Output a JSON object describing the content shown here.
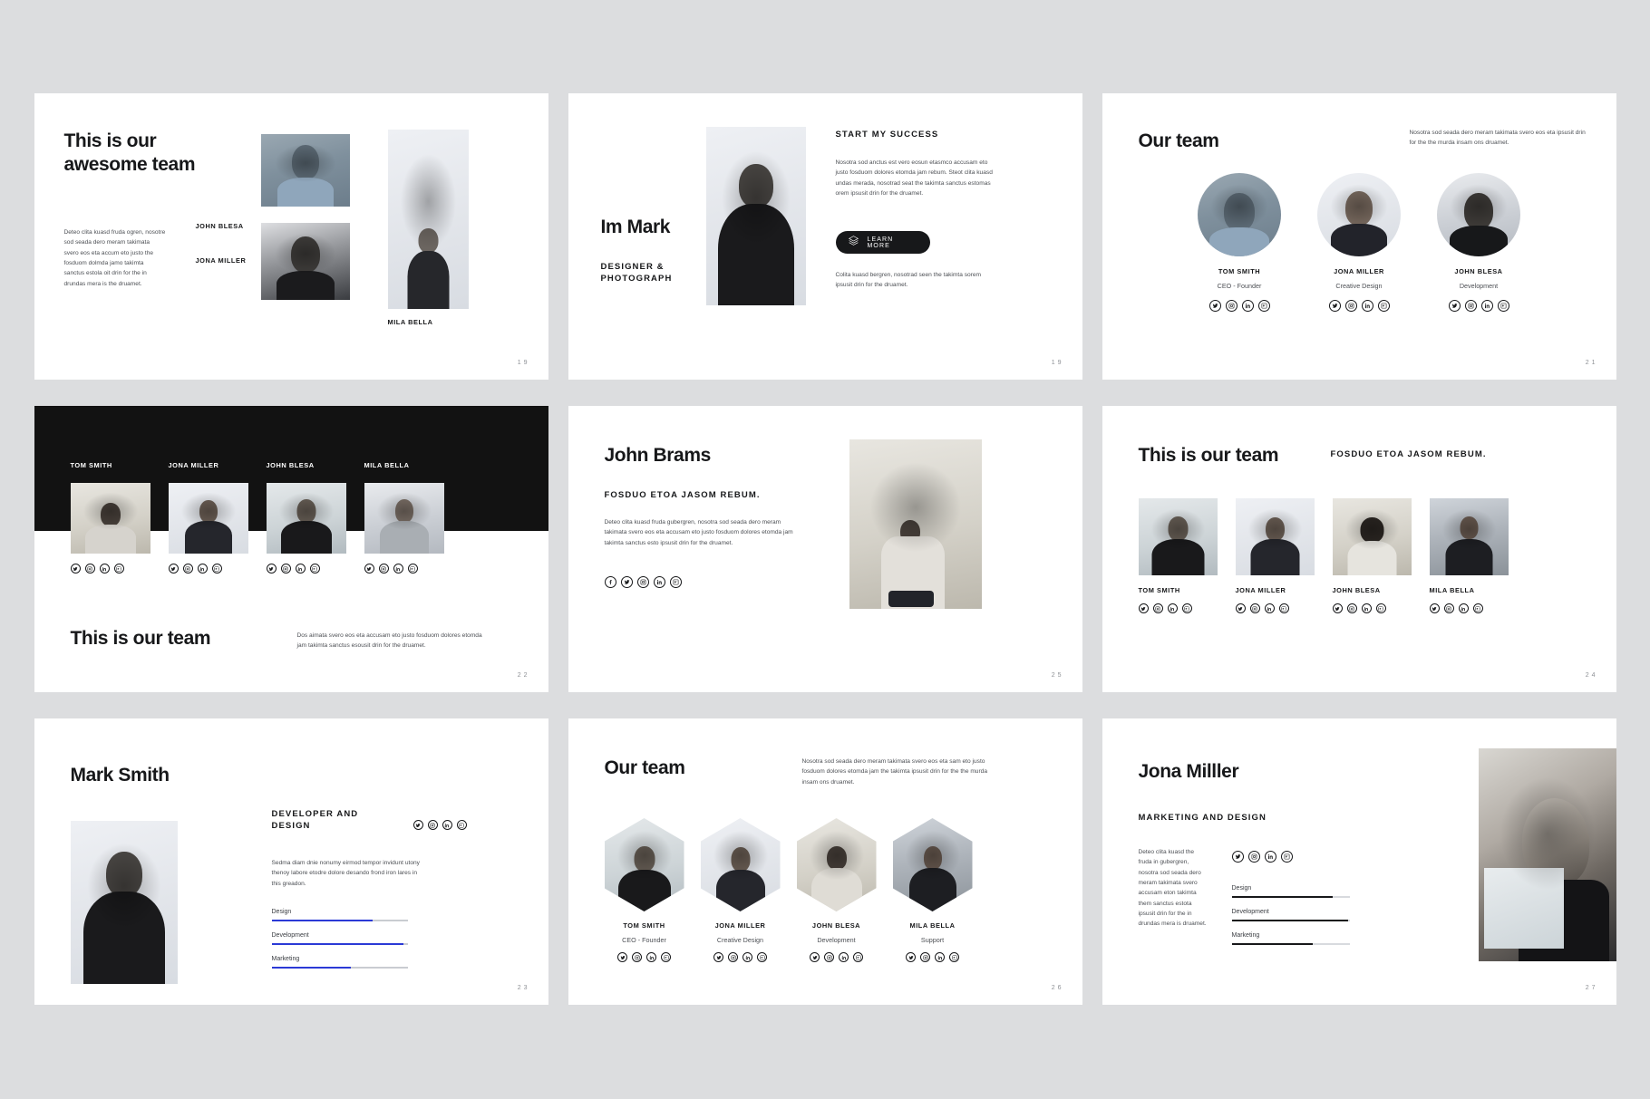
{
  "social_icons": [
    "twitter-icon",
    "instagram-icon",
    "linkedin-icon",
    "behance-icon"
  ],
  "social_icons_full": [
    "facebook-icon",
    "twitter-icon",
    "instagram-icon",
    "linkedin-icon",
    "behance-icon"
  ],
  "colors": {
    "accent": "#2b3ad6",
    "dark": "#121212",
    "body_text": "#4c4f54",
    "page_bg": "#dcdddf"
  },
  "slides": [
    {
      "id": "awesome-team",
      "page": "19",
      "title": "This is our\nawesome team",
      "paragraph": "Deteo clita kuasd fruda ogren, nosotre sod seada dero meram takimata svero eos eta accum eto justo the fosduom dolmda jamo takimta sanctus estola oit drin for the in drundas mera is the druamet.",
      "labels": {
        "john": "JOHN BLESA",
        "jona": "JONA MILLER",
        "mila": "MILA BELLA"
      }
    },
    {
      "id": "im-mark",
      "page": "19",
      "name": "Im Mark",
      "subtitle": "DESIGNER &\nPHOTOGRAPH",
      "kicker": "START MY SUCCESS",
      "paragraph": "Nosotra sod anctus est vero eosun etasmco accusam eto justo fosduom dolores etomda jam rebum. Steot clita kuasd undas merada, nosotrad seat the takimta sanctus estomas orem ipsusit drin for the druamet.",
      "button_label": "LEARN MORE",
      "paragraph2": "Colita kuasd bergren, nosotrad seen the takimta sorem ipsusit drin for the druamet."
    },
    {
      "id": "our-team-circles",
      "page": "21",
      "title": "Our team",
      "note": "Nosotra sod seada dero meram takimata svero eos eta ipsusit drin for the the murda insam ons druamet.",
      "members": [
        {
          "name": "TOM SMITH",
          "role": "CEO - Founder"
        },
        {
          "name": "JONA MILLER",
          "role": "Creative Design"
        },
        {
          "name": "JOHN BLESA",
          "role": "Development"
        }
      ]
    },
    {
      "id": "this-is-our-team-dark",
      "page": "22",
      "title": "This is our team",
      "paragraph": "Dos aimata svero eos eta accusam eto justo fosduom dolores etomda jam takimta sanctus esousit drin for the druamet.",
      "members": [
        {
          "name": "TOM SMITH"
        },
        {
          "name": "JONA MILLER"
        },
        {
          "name": "JOHN BLESA"
        },
        {
          "name": "MILA BELLA"
        }
      ]
    },
    {
      "id": "john-brams",
      "page": "25",
      "title": "John Brams",
      "kicker": "FOSDUO ETOA JASOM REBUM.",
      "paragraph": "Deteo clita kuasd fruda gubergren, nosotra sod seada dero meram takimata svero eos eta accusam eto justo fosduom dolores etomda jam takimta sanctus esto ipsusit drin for the druamet."
    },
    {
      "id": "this-is-our-team-light",
      "page": "24",
      "title": "This is our team",
      "kicker": "FOSDUO ETOA JASOM REBUM.",
      "members": [
        {
          "name": "TOM SMITH"
        },
        {
          "name": "JONA MILLER"
        },
        {
          "name": "JOHN BLESA"
        },
        {
          "name": "MILA BELLA"
        }
      ]
    },
    {
      "id": "mark-smith",
      "page": "23",
      "title": "Mark Smith",
      "kicker": "DEVELOPER AND\nDESIGN",
      "paragraph": "Sedma diam dnie nonumy eirmod tempor invidunt utony thenoy labore etodre dolore desando frond iron lares in this greadon.",
      "skills": [
        {
          "label": "Design",
          "value": 74
        },
        {
          "label": "Development",
          "value": 97
        },
        {
          "label": "Marketing",
          "value": 58
        }
      ]
    },
    {
      "id": "our-team-hex",
      "page": "26",
      "title": "Our team",
      "note": "Nosotra sod seada dero meram takimata svero eos eta sam eto justo fosduom dolores etomda jam the takimta ipsusit drin for the the murda insam ons druamet.",
      "members": [
        {
          "name": "TOM SMITH",
          "role": "CEO - Founder"
        },
        {
          "name": "JONA MILLER",
          "role": "Creative Design"
        },
        {
          "name": "JOHN BLESA",
          "role": "Development"
        },
        {
          "name": "MILA BELLA",
          "role": "Support"
        }
      ]
    },
    {
      "id": "jona-milller",
      "page": "27",
      "title": "Jona Milller",
      "kicker": "MARKETING AND DESIGN",
      "paragraph": "Deteo clita kuasd the fruda in gubergren, nosotra sod seada dero meram takimata svero accusam eton takimta them sanctus estota ipsusit drin for the in drundas mera is druamet.",
      "skills": [
        {
          "label": "Design",
          "value": 86
        },
        {
          "label": "Development",
          "value": 99
        },
        {
          "label": "Marketing",
          "value": 69
        }
      ]
    }
  ]
}
